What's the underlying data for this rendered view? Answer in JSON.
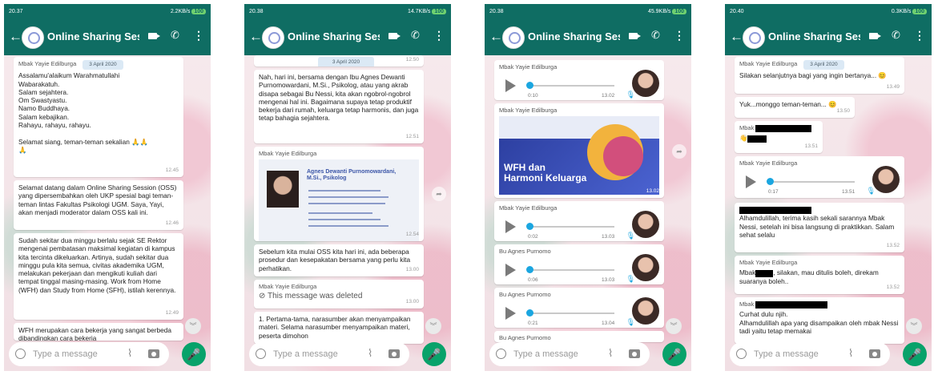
{
  "app": {
    "chat_title": "Online Sharing Ses...",
    "input_placeholder_1": "Type a message",
    "input_placeholder": "Type a message"
  },
  "phones": [
    {
      "status_time": "20.37",
      "status_right": "2.2KB/s",
      "battery": "100",
      "sender": "Mbak Yayie Edilburga",
      "date": "3 April 2020",
      "msg1": "Assalamu'alaikum Warahmatullahi\nWabarakatuh.\nSalam sejahtera.\nOm Swastyastu.\nNamo Buddhaya.\nSalam kebajikan.\nRahayu, rahayu, rahayu.\n\nSelamat siang, teman-teman sekalian 🙏🙏\n🙏",
      "msg1_time": "12.45",
      "msg2": "Selamat datang dalam Online Sharing Session (OSS) yang dipersembahkan oleh UKP spesial bagi teman-teman lintas Fakultas Psikologi UGM. Saya, Yayi, akan menjadi moderator dalam OSS kali ini.",
      "msg2_time": "12.46",
      "msg3": "Sudah sekitar dua minggu berlalu sejak SE Rektor mengenai pembatasan maksimal kegiatan di kampus kita tercinta dikeluarkan. Artinya, sudah sekitar dua minggu pula kita semua, civitas akademika UGM, melakukan pekerjaan dan mengikuti kuliah dari tempat tinggal masing-masing. Work from Home (WFH) dan Study from Home (SFH), istilah kerennya.",
      "msg3_time": "12.49",
      "msg4": "WFH merupakan cara bekerja yang sangat berbeda dibandingkan cara bekerja"
    },
    {
      "status_time": "20.38",
      "status_right": "14.7KB/s",
      "battery": "100",
      "date": "3 April 2020",
      "date_time": "12.50",
      "msg1": "Nah, hari ini, bersama dengan Ibu Agnes Dewanti Purnomowardani, M.Si., Psikolog, atau yang akrab disapa sebagai Bu Nessi, kita akan ngobrol-ngobrol mengenai hal ini. Bagaimana supaya tetap produktif bekerja dari rumah, keluarga tetap harmonis, dan juga tetap bahagia sejahtera.",
      "msg1_time": "12.51",
      "sender": "Mbak Yayie Edilburga",
      "slide_title": "Agnes Dewanti Purnomowardani, M.Si., Psikolog",
      "slide_time": "12.54",
      "msg2": "Sebelum kita mulai OSS kita hari ini, ada beberapa prosedur dan kesepakatan bersama yang perlu kita perhatikan.",
      "msg2_time": "13.00",
      "sender2": "Mbak Yayie Edilburga",
      "deleted": "This message was deleted",
      "deleted_time": "13.00",
      "msg3": "1. Pertama-tama, narasumber akan menyampaikan materi. Selama narasumber menyampaikan materi, peserta dimohon"
    },
    {
      "status_time": "20.38",
      "status_right": "45.9KB/s",
      "battery": "100",
      "sender_a": "Mbak Yayie Edilburga",
      "audio1_dur": "0:10",
      "audio1_time": "13.02",
      "sender_b": "Mbak Yayie Edilburga",
      "poster_title": "WFH dan\nHarmoni Keluarga",
      "poster_time": "13.02",
      "sender_c": "Mbak Yayie Edilburga",
      "audio2_dur": "0:02",
      "audio2_time": "13.03",
      "sender_d": "Bu Agnes Purnomo",
      "audio3_dur": "0:06",
      "audio3_time": "13.03",
      "sender_e": "Bu Agnes Purnomo",
      "audio4_dur": "0:21",
      "audio4_time": "13.04",
      "sender_f": "Bu Agnes Purnomo"
    },
    {
      "status_time": "20.40",
      "status_right": "0.3KB/s",
      "battery": "100",
      "sender": "Mbak Yayie Edilburga",
      "date": "3 April 2020",
      "msg1": "Silakan selanjutnya bagi yang ingin bertanya... 😊",
      "msg1_time": "13.49",
      "msg2": "Yuk...monggo teman-teman... 😊",
      "msg2_time": "13.50",
      "sender_b": "Mbak",
      "msg3_time": "13.51",
      "sender_c": "Mbak Yayie Edilburga",
      "audio_dur": "0:17",
      "audio_time": "13.51",
      "msg4": "Alhamdulillah, terima kasih sekali sarannya Mbak Nessi, setelah ini bisa langsung di praktikkan. Salam sehat selalu",
      "msg4_time": "13.52",
      "sender_d": "Mbak Yayie Edilburga",
      "msg5_a": "Mbak",
      "msg5_b": ", silakan, mau ditulis boleh, direkam suaranya boleh..",
      "msg5_time": "13.52",
      "sender_e": "Mbak",
      "msg6": "Curhat dulu njih.\nAlhamdulillah apa yang disampaikan oleh mbak Nessi tadi yaitu tetap memakai"
    }
  ]
}
